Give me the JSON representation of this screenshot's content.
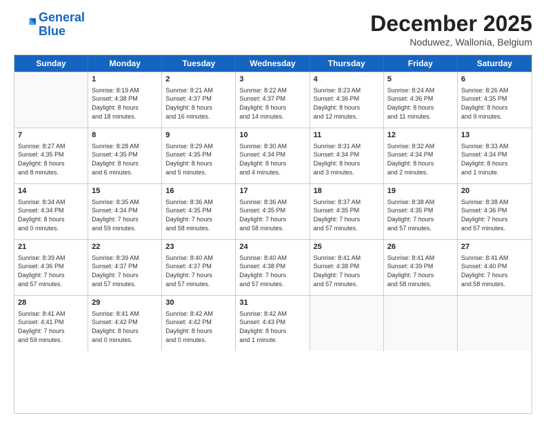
{
  "logo": {
    "line1": "General",
    "line2": "Blue"
  },
  "title": "December 2025",
  "subtitle": "Noduwez, Wallonia, Belgium",
  "days": [
    "Sunday",
    "Monday",
    "Tuesday",
    "Wednesday",
    "Thursday",
    "Friday",
    "Saturday"
  ],
  "weeks": [
    [
      {
        "day": "",
        "info": ""
      },
      {
        "day": "1",
        "info": "Sunrise: 8:19 AM\nSunset: 4:38 PM\nDaylight: 8 hours\nand 18 minutes."
      },
      {
        "day": "2",
        "info": "Sunrise: 8:21 AM\nSunset: 4:37 PM\nDaylight: 8 hours\nand 16 minutes."
      },
      {
        "day": "3",
        "info": "Sunrise: 8:22 AM\nSunset: 4:37 PM\nDaylight: 8 hours\nand 14 minutes."
      },
      {
        "day": "4",
        "info": "Sunrise: 8:23 AM\nSunset: 4:36 PM\nDaylight: 8 hours\nand 12 minutes."
      },
      {
        "day": "5",
        "info": "Sunrise: 8:24 AM\nSunset: 4:36 PM\nDaylight: 8 hours\nand 11 minutes."
      },
      {
        "day": "6",
        "info": "Sunrise: 8:26 AM\nSunset: 4:35 PM\nDaylight: 8 hours\nand 9 minutes."
      }
    ],
    [
      {
        "day": "7",
        "info": "Sunrise: 8:27 AM\nSunset: 4:35 PM\nDaylight: 8 hours\nand 8 minutes."
      },
      {
        "day": "8",
        "info": "Sunrise: 8:28 AM\nSunset: 4:35 PM\nDaylight: 8 hours\nand 6 minutes."
      },
      {
        "day": "9",
        "info": "Sunrise: 8:29 AM\nSunset: 4:35 PM\nDaylight: 8 hours\nand 5 minutes."
      },
      {
        "day": "10",
        "info": "Sunrise: 8:30 AM\nSunset: 4:34 PM\nDaylight: 8 hours\nand 4 minutes."
      },
      {
        "day": "11",
        "info": "Sunrise: 8:31 AM\nSunset: 4:34 PM\nDaylight: 8 hours\nand 3 minutes."
      },
      {
        "day": "12",
        "info": "Sunrise: 8:32 AM\nSunset: 4:34 PM\nDaylight: 8 hours\nand 2 minutes."
      },
      {
        "day": "13",
        "info": "Sunrise: 8:33 AM\nSunset: 4:34 PM\nDaylight: 8 hours\nand 1 minute."
      }
    ],
    [
      {
        "day": "14",
        "info": "Sunrise: 8:34 AM\nSunset: 4:34 PM\nDaylight: 8 hours\nand 0 minutes."
      },
      {
        "day": "15",
        "info": "Sunrise: 8:35 AM\nSunset: 4:34 PM\nDaylight: 7 hours\nand 59 minutes."
      },
      {
        "day": "16",
        "info": "Sunrise: 8:36 AM\nSunset: 4:35 PM\nDaylight: 7 hours\nand 58 minutes."
      },
      {
        "day": "17",
        "info": "Sunrise: 8:36 AM\nSunset: 4:35 PM\nDaylight: 7 hours\nand 58 minutes."
      },
      {
        "day": "18",
        "info": "Sunrise: 8:37 AM\nSunset: 4:35 PM\nDaylight: 7 hours\nand 57 minutes."
      },
      {
        "day": "19",
        "info": "Sunrise: 8:38 AM\nSunset: 4:35 PM\nDaylight: 7 hours\nand 57 minutes."
      },
      {
        "day": "20",
        "info": "Sunrise: 8:38 AM\nSunset: 4:36 PM\nDaylight: 7 hours\nand 57 minutes."
      }
    ],
    [
      {
        "day": "21",
        "info": "Sunrise: 8:39 AM\nSunset: 4:36 PM\nDaylight: 7 hours\nand 57 minutes."
      },
      {
        "day": "22",
        "info": "Sunrise: 8:39 AM\nSunset: 4:37 PM\nDaylight: 7 hours\nand 57 minutes."
      },
      {
        "day": "23",
        "info": "Sunrise: 8:40 AM\nSunset: 4:37 PM\nDaylight: 7 hours\nand 57 minutes."
      },
      {
        "day": "24",
        "info": "Sunrise: 8:40 AM\nSunset: 4:38 PM\nDaylight: 7 hours\nand 57 minutes."
      },
      {
        "day": "25",
        "info": "Sunrise: 8:41 AM\nSunset: 4:38 PM\nDaylight: 7 hours\nand 57 minutes."
      },
      {
        "day": "26",
        "info": "Sunrise: 8:41 AM\nSunset: 4:39 PM\nDaylight: 7 hours\nand 58 minutes."
      },
      {
        "day": "27",
        "info": "Sunrise: 8:41 AM\nSunset: 4:40 PM\nDaylight: 7 hours\nand 58 minutes."
      }
    ],
    [
      {
        "day": "28",
        "info": "Sunrise: 8:41 AM\nSunset: 4:41 PM\nDaylight: 7 hours\nand 59 minutes."
      },
      {
        "day": "29",
        "info": "Sunrise: 8:41 AM\nSunset: 4:42 PM\nDaylight: 8 hours\nand 0 minutes."
      },
      {
        "day": "30",
        "info": "Sunrise: 8:42 AM\nSunset: 4:42 PM\nDaylight: 8 hours\nand 0 minutes."
      },
      {
        "day": "31",
        "info": "Sunrise: 8:42 AM\nSunset: 4:43 PM\nDaylight: 8 hours\nand 1 minute."
      },
      {
        "day": "",
        "info": ""
      },
      {
        "day": "",
        "info": ""
      },
      {
        "day": "",
        "info": ""
      }
    ]
  ]
}
